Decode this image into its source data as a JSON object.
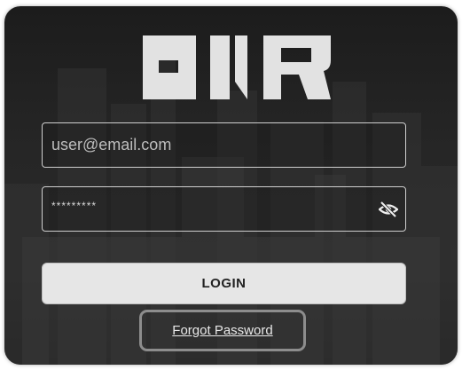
{
  "logo": {
    "text": "ONR",
    "color": "#e2e2e2"
  },
  "form": {
    "email_placeholder": "user@email.com",
    "password_value": "*********",
    "toggle_icon": "eye-slash-icon",
    "login_label": "LOGIN",
    "forgot_label": "Forgot Password"
  },
  "colors": {
    "background": "#252525",
    "field_border": "#cfcfcf",
    "button_bg": "#e6e6e6",
    "focus_ring": "#8d8d8d"
  }
}
